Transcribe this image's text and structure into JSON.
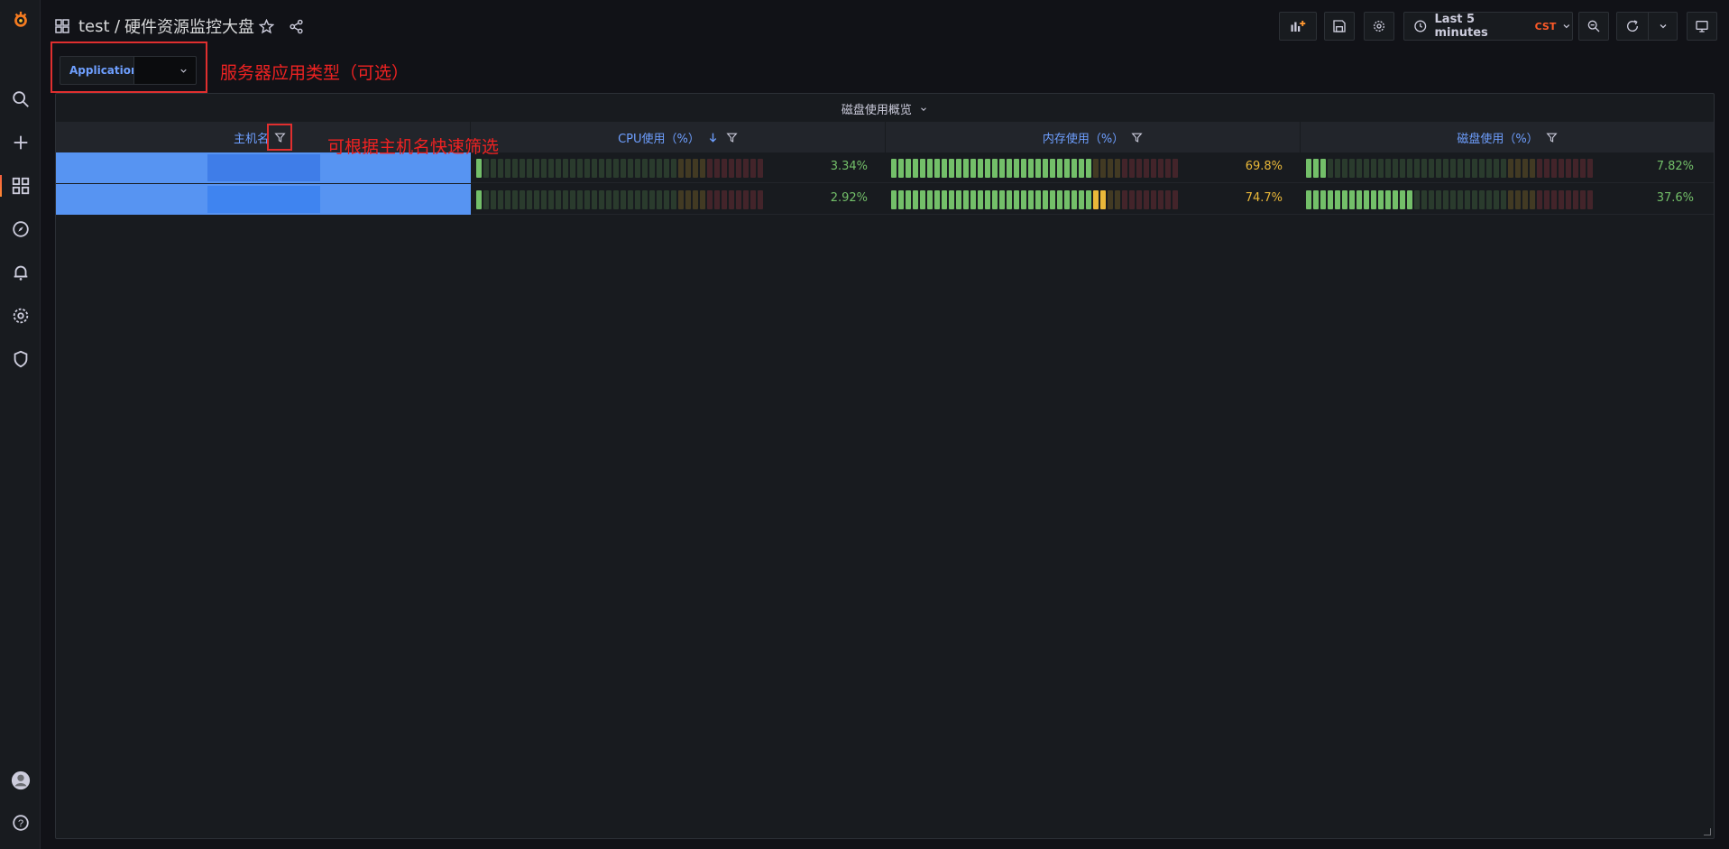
{
  "nav": {
    "dashboard_name": "test",
    "breadcrumb_separator": "/",
    "dashboard_title": "硬件资源监控大盘",
    "time_range_label": "Last 5 minutes",
    "timezone": "CST"
  },
  "variables": {
    "application_label": "Application",
    "application_value": ""
  },
  "annotations": {
    "variable_note": "服务器应用类型（可选）",
    "filter_note": "可根据主机名快速筛选"
  },
  "panel": {
    "title": "磁盘使用概览",
    "columns": {
      "host": "主机名",
      "cpu": "CPU使用（%）",
      "mem": "内存使用（%）",
      "disk": "磁盘使用（%）"
    },
    "rows": [
      {
        "host": "",
        "cpu": {
          "value": 3.34,
          "label": "3.34%",
          "color": "#73bf69"
        },
        "mem": {
          "value": 69.8,
          "label": "69.8%",
          "color": "#eab839"
        },
        "disk": {
          "value": 7.82,
          "label": "7.82%",
          "color": "#73bf69"
        }
      },
      {
        "host": "",
        "cpu": {
          "value": 2.92,
          "label": "2.92%",
          "color": "#73bf69"
        },
        "mem": {
          "value": 74.7,
          "label": "74.7%",
          "color": "#eab839"
        },
        "disk": {
          "value": 37.6,
          "label": "37.6%",
          "color": "#73bf69"
        }
      }
    ]
  },
  "colors": {
    "green": "#73bf69",
    "yellow": "#eab839",
    "red": "#f2495c",
    "host_fill": "#5794f2",
    "accent": "#6e9fff",
    "annotation": "#ee2222"
  }
}
